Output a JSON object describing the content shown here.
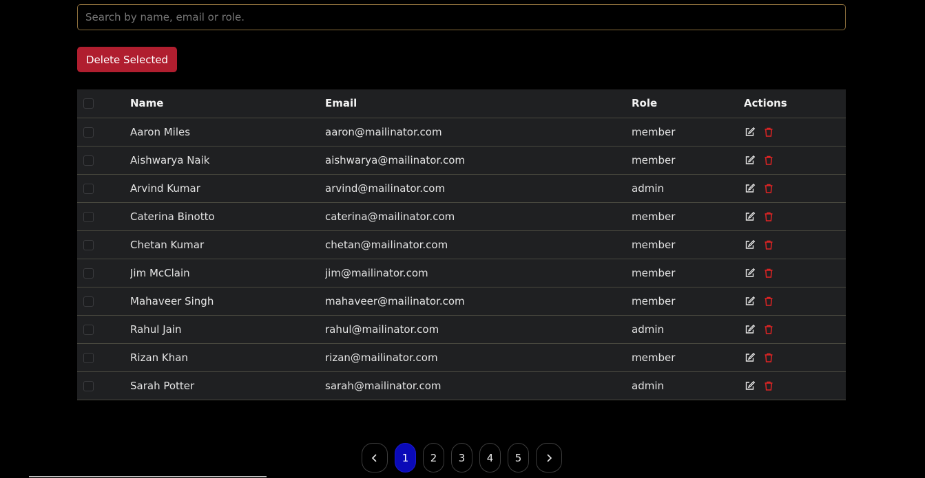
{
  "search": {
    "placeholder": "Search by name, email or role.",
    "value": ""
  },
  "toolbar": {
    "delete_label": "Delete Selected"
  },
  "table": {
    "headers": {
      "name": "Name",
      "email": "Email",
      "role": "Role",
      "actions": "Actions"
    },
    "rows": [
      {
        "name": "Aaron Miles",
        "email": "aaron@mailinator.com",
        "role": "member"
      },
      {
        "name": "Aishwarya Naik",
        "email": "aishwarya@mailinator.com",
        "role": "member"
      },
      {
        "name": "Arvind Kumar",
        "email": "arvind@mailinator.com",
        "role": "admin"
      },
      {
        "name": "Caterina Binotto",
        "email": "caterina@mailinator.com",
        "role": "member"
      },
      {
        "name": "Chetan Kumar",
        "email": "chetan@mailinator.com",
        "role": "member"
      },
      {
        "name": "Jim McClain",
        "email": "jim@mailinator.com",
        "role": "member"
      },
      {
        "name": "Mahaveer Singh",
        "email": "mahaveer@mailinator.com",
        "role": "member"
      },
      {
        "name": "Rahul Jain",
        "email": "rahul@mailinator.com",
        "role": "admin"
      },
      {
        "name": "Rizan Khan",
        "email": "rizan@mailinator.com",
        "role": "member"
      },
      {
        "name": "Sarah Potter",
        "email": "sarah@mailinator.com",
        "role": "admin"
      }
    ],
    "row_icons": {
      "edit": "edit-icon",
      "delete": "trash-icon"
    }
  },
  "pagination": {
    "pages": [
      "1",
      "2",
      "3",
      "4",
      "5"
    ],
    "current": "1",
    "prev_icon": "chevron-left-icon",
    "next_icon": "chevron-right-icon"
  },
  "colors": {
    "background": "#000000",
    "row_bg": "#1f2022",
    "danger": "#b01e2f",
    "trash_icon": "#e02424",
    "active_page": "#0a0ab8",
    "search_border": "#8a6d3b"
  }
}
